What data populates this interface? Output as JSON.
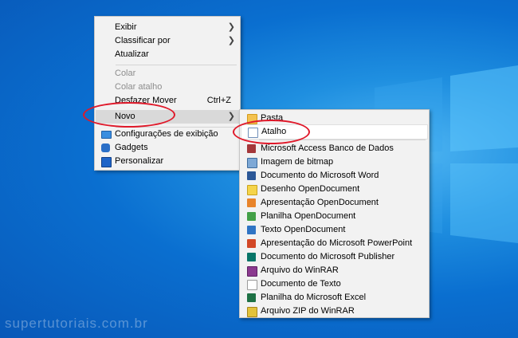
{
  "context_menu": {
    "items": [
      {
        "label": "Exibir",
        "has_submenu": true
      },
      {
        "label": "Classificar por",
        "has_submenu": true
      },
      {
        "label": "Atualizar"
      },
      {
        "label": "Colar",
        "disabled": true
      },
      {
        "label": "Colar atalho",
        "disabled": true
      },
      {
        "label": "Desfazer Mover",
        "shortcut": "Ctrl+Z"
      },
      {
        "label": "Novo",
        "has_submenu": true
      },
      {
        "label": "Configurações de exibição",
        "icon": "display-icon"
      },
      {
        "label": "Gadgets",
        "icon": "gadgets-icon"
      },
      {
        "label": "Personalizar",
        "icon": "personalize-icon"
      }
    ]
  },
  "submenu_novo": {
    "items": [
      {
        "label": "Pasta",
        "icon": "folder-icon"
      },
      {
        "label": "Atalho",
        "icon": "shortcut-icon"
      },
      {
        "label": "Microsoft Access Banco de Dados",
        "icon": "access-icon"
      },
      {
        "label": "Imagem de bitmap",
        "icon": "bitmap-icon"
      },
      {
        "label": "Documento do Microsoft Word",
        "icon": "word-icon"
      },
      {
        "label": "Desenho OpenDocument",
        "icon": "odg-icon"
      },
      {
        "label": "Apresentação OpenDocument",
        "icon": "odp-icon"
      },
      {
        "label": "Planilha OpenDocument",
        "icon": "ods-icon"
      },
      {
        "label": "Texto OpenDocument",
        "icon": "odt-icon"
      },
      {
        "label": "Apresentação do Microsoft PowerPoint",
        "icon": "powerpoint-icon"
      },
      {
        "label": "Documento do Microsoft Publisher",
        "icon": "publisher-icon"
      },
      {
        "label": "Arquivo do WinRAR",
        "icon": "winrar-icon"
      },
      {
        "label": "Documento de Texto",
        "icon": "text-document-icon"
      },
      {
        "label": "Planilha do Microsoft Excel",
        "icon": "excel-icon"
      },
      {
        "label": "Arquivo ZIP do WinRAR",
        "icon": "winrar-zip-icon"
      }
    ]
  },
  "watermark": "supertutoriais.com.br",
  "colors": {
    "desktop_blue": "#0a6fd0",
    "menu_bg": "#f2f2f2",
    "highlight_ring": "#e0192a"
  }
}
